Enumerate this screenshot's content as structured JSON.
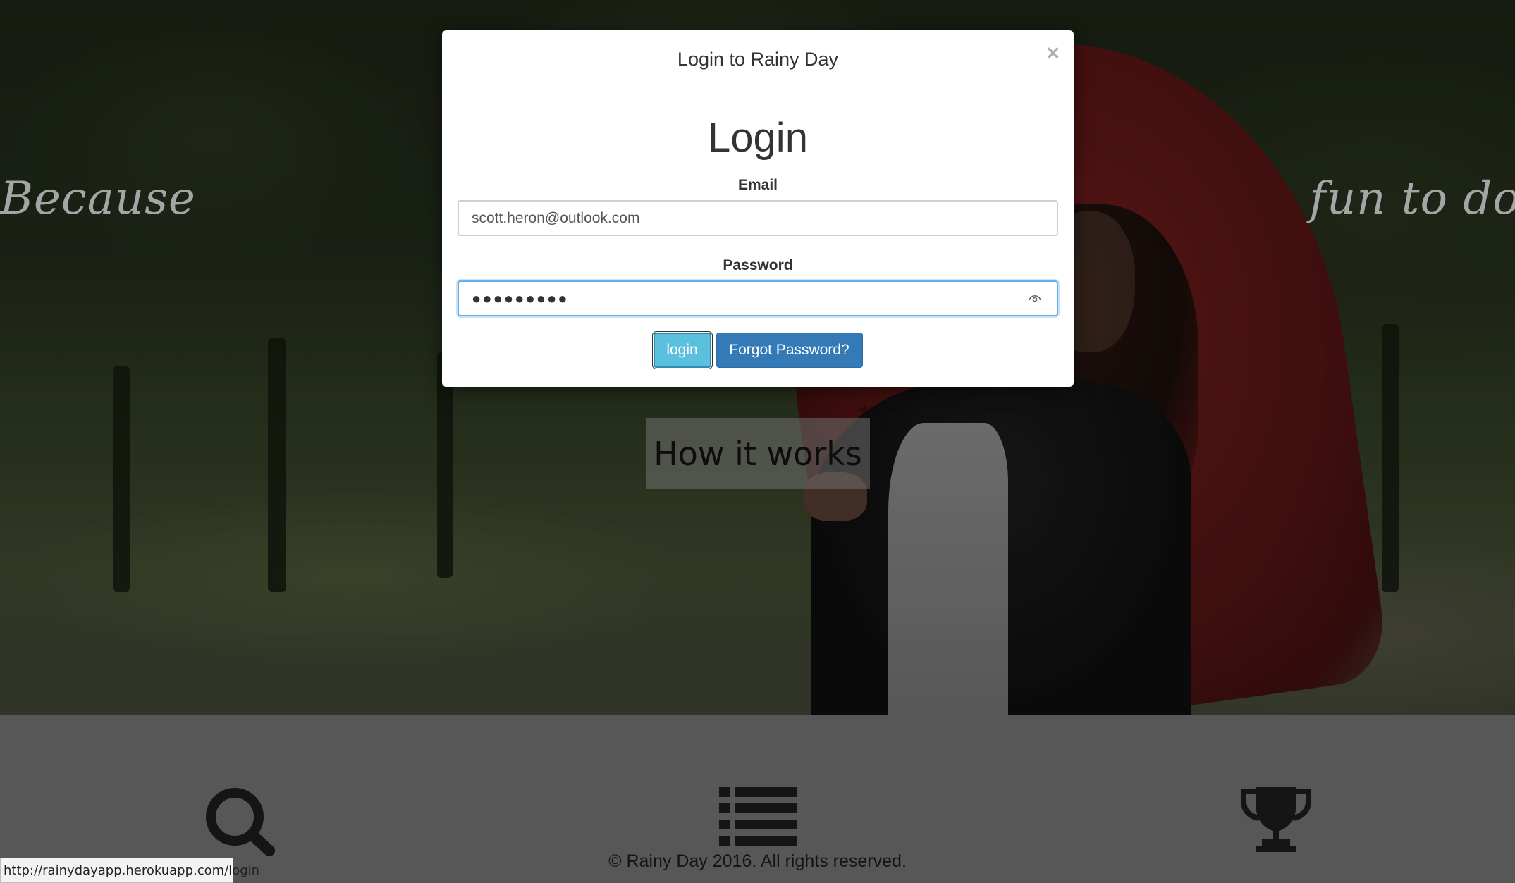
{
  "hero": {
    "tagline": "Because                                                                          fun to do",
    "how_it_works_label": "How it works"
  },
  "modal": {
    "title": "Login to Rainy Day",
    "close_label": "×",
    "heading": "Login",
    "email_label": "Email",
    "email_value": "scott.heron@outlook.com",
    "password_label": "Password",
    "password_masked": "●●●●●●●●●",
    "login_button": "login",
    "forgot_button": "Forgot Password?"
  },
  "features": {
    "icons": [
      "search-icon",
      "list-icon",
      "trophy-icon"
    ]
  },
  "footer": {
    "copyright": "© Rainy Day 2016. All rights reserved."
  },
  "status_bar": {
    "url": "http://rainydayapp.herokuapp.com/login"
  },
  "colors": {
    "login_button": "#5bc0de",
    "forgot_button": "#337ab7",
    "focus_border": "#66afe9"
  }
}
